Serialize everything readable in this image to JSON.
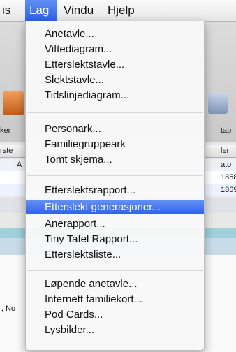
{
  "menubar": {
    "items": [
      {
        "label": "is"
      },
      {
        "label": "Lag"
      },
      {
        "label": "Vindu"
      },
      {
        "label": "Hjelp"
      }
    ]
  },
  "background": {
    "toolbar_labels": [
      "ker",
      "tap"
    ],
    "column_headers": [
      "rste",
      "ler",
      "ato"
    ],
    "first_col": "A",
    "rows": [
      {
        "value": "1858"
      },
      {
        "value": "1869"
      }
    ],
    "footer_fragment": ", No"
  },
  "menu": {
    "groups": [
      [
        "Anetavle...",
        "Viftediagram...",
        "Etterslektstavle...",
        "Slektstavle...",
        "Tidslinjediagram..."
      ],
      [
        "Personark...",
        "Familiegruppeark",
        "Tomt skjema..."
      ],
      [
        "Etterslektsrapport...",
        "Etterslekt generasjoner...",
        "Anerapport...",
        "Tiny Tafel Rapport...",
        "Etterslektsliste..."
      ],
      [
        "Løpende anetavle...",
        "Internett familiekort...",
        "Pod Cards...",
        "Lysbilder..."
      ]
    ],
    "highlighted": "Etterslekt generasjoner..."
  }
}
